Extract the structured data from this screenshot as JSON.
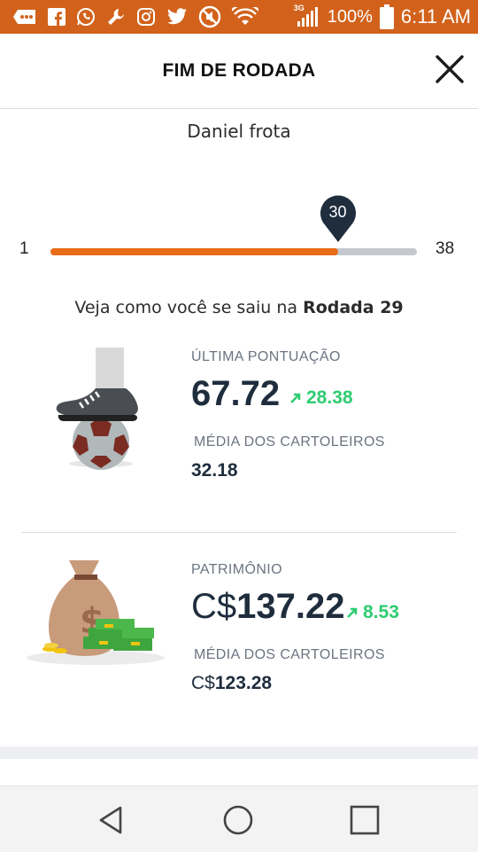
{
  "status_bar": {
    "left_icons": [
      "message-icon",
      "facebook-icon",
      "whatsapp-icon",
      "wrench-icon",
      "instagram-icon",
      "twitter-icon",
      "no-sound-icon",
      "wifi-icon"
    ],
    "network_label": "3G",
    "battery": "100%",
    "time": "6:11 AM"
  },
  "header": {
    "title": "FIM DE RODADA",
    "close_icon": "close-icon"
  },
  "user": {
    "name": "Daniel frota"
  },
  "slider": {
    "min": "1",
    "max": "38",
    "current": "30",
    "progress": 0.784
  },
  "info": {
    "prefix": "Veja como você se saiu na ",
    "round": "Rodada 29"
  },
  "score": {
    "label": "ÚLTIMA PONTUAÇÃO",
    "value": "67.72",
    "delta": "28.38",
    "avg_label": "MÉDIA DOS CARTOLEIROS",
    "avg_value": "32.18"
  },
  "assets": {
    "label": "PATRIMÔNIO",
    "currency": "C$",
    "value": "137.22",
    "delta": "8.53",
    "avg_label": "MÉDIA DOS CARTOLEIROS",
    "avg_currency": "C$",
    "avg_value": "123.28"
  },
  "colors": {
    "status_bar": "#d2621b",
    "accent": "#e96c16",
    "pin": "#1f2d3d",
    "positive": "#2ecc71"
  },
  "nav": {
    "back": "back-triangle-icon",
    "home": "home-circle-icon",
    "recents": "recents-square-icon"
  }
}
